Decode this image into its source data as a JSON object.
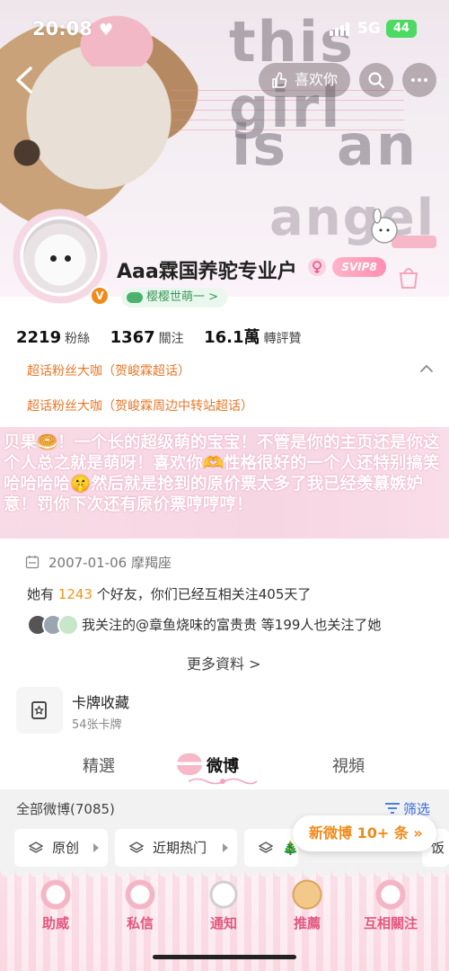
{
  "status_bar": {
    "time": "20:08",
    "network": "5G",
    "battery": "44"
  },
  "header": {
    "like_label": "喜欢你",
    "cover_texts": [
      "this girl",
      "is",
      "an",
      "angel"
    ]
  },
  "profile": {
    "name": "Aaa霖国养驼专业户",
    "verified_badge": "V",
    "svip": "SVIP8",
    "fan_tag": "樱樱世萌一 >",
    "stats": [
      {
        "value": "2219",
        "label": "粉絲"
      },
      {
        "value": "1367",
        "label": "關注"
      },
      {
        "value": "16.1萬",
        "label": "轉評贊"
      }
    ],
    "chaohua": [
      "超话粉丝大咖（贺峻霖超话）",
      "超话粉丝大咖（贺峻霖周边中转站超话）"
    ],
    "bio": "贝果🥯！一个长的超级萌的宝宝！不管是你的主页还是你这个人总之就是萌呀！喜欢你🫶性格很好的一个人还特别搞笑哈哈哈哈🤫然后就是抢到的原价票太多了我已经羡慕嫉妒意！罚你下次还有原价票哼哼哼！",
    "birthday_line": "2007-01-06 摩羯座",
    "friends": {
      "prefix": "她有 ",
      "count": "1243",
      "suffix": " 个好友，你们已经互相关注405天了"
    },
    "mutual": "我关注的@章鱼烧味的富贵贵 等199人也关注了她",
    "more_info": "更多資料 >"
  },
  "cards": {
    "title": "卡牌收藏",
    "subtitle": "54张卡牌"
  },
  "tabs": [
    "精選",
    "微博",
    "視頻"
  ],
  "feed": {
    "all_label": "全部微博(7085)",
    "filter_label": "筛选",
    "chips": [
      "原创",
      "近期热门",
      "🎄",
      "饭"
    ],
    "new_pill": "新微博 10+ 条"
  },
  "bottom_nav": [
    "助威",
    "私信",
    "通知",
    "推薦",
    "互相關注"
  ],
  "colors": {
    "accent_orange": "#e8772a",
    "pink": "#e2587f",
    "link_blue": "#3a6fd8"
  }
}
